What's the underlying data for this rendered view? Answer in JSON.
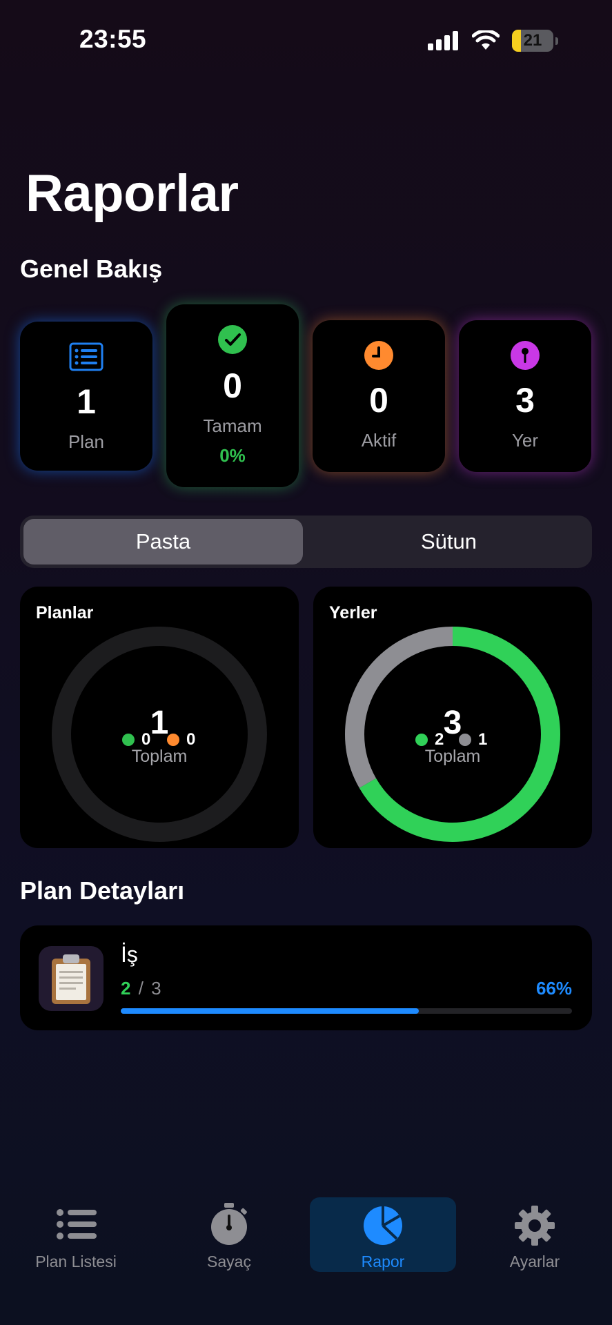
{
  "status_bar": {
    "time": "23:55",
    "battery": "21",
    "battery_level": 0.21
  },
  "page_title": "Raporlar",
  "overview": {
    "title": "Genel Bakış",
    "cards": [
      {
        "value": "1",
        "label": "Plan",
        "icon": "list-icon",
        "color": "#1f7ff0"
      },
      {
        "value": "0",
        "label": "Tamam",
        "sub": "0%",
        "icon": "checkmark-icon",
        "color": "#30c04f"
      },
      {
        "value": "0",
        "label": "Aktif",
        "icon": "clock-icon",
        "color": "#ff8a2f"
      },
      {
        "value": "3",
        "label": "Yer",
        "icon": "pin-icon",
        "color": "#c938e6"
      }
    ]
  },
  "segment": {
    "options": [
      "Pasta",
      "Sütun"
    ],
    "selected": "Pasta"
  },
  "chart_data": [
    {
      "type": "pie",
      "title": "Planlar",
      "total": 1,
      "total_label": "Toplam",
      "slices": [
        {
          "value": 0,
          "color": "#30c04f"
        },
        {
          "value": 0,
          "color": "#ff8a2f"
        }
      ]
    },
    {
      "type": "pie",
      "title": "Yerler",
      "total": 3,
      "total_label": "Toplam",
      "slices": [
        {
          "value": 2,
          "color": "#30d158"
        },
        {
          "value": 1,
          "color": "#8e8e93"
        }
      ]
    }
  ],
  "plan_details": {
    "title": "Plan Detayları",
    "items": [
      {
        "name": "İş",
        "done": "2",
        "total": "3",
        "separator": "/",
        "percent": "66%",
        "progress": 0.66,
        "icon": "clipboard-icon"
      }
    ]
  },
  "tab_bar": {
    "tabs": [
      {
        "label": "Plan Listesi",
        "icon": "list-icon"
      },
      {
        "label": "Sayaç",
        "icon": "stopwatch-icon"
      },
      {
        "label": "Rapor",
        "icon": "pie-chart-icon",
        "active": true
      },
      {
        "label": "Ayarlar",
        "icon": "gear-icon"
      }
    ]
  }
}
